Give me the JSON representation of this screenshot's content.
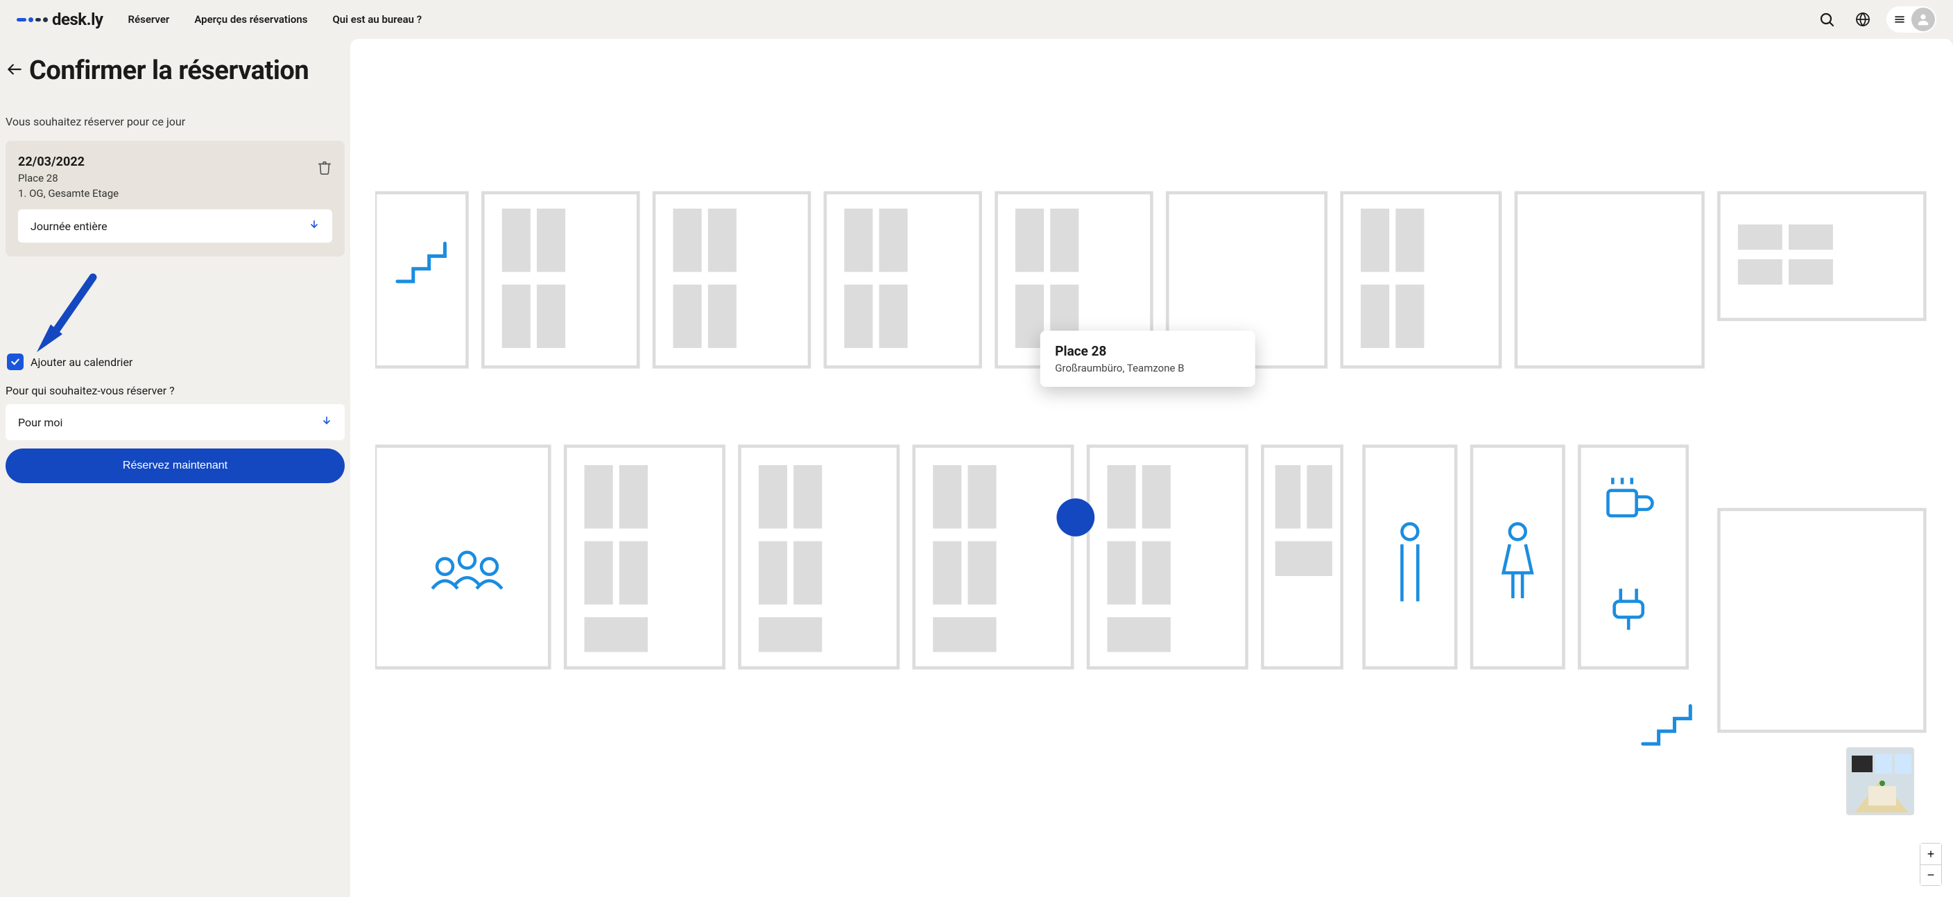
{
  "brand": {
    "name": "desk.ly"
  },
  "nav": {
    "reserve": "Réserver",
    "overview": "Aperçu des réservations",
    "who": "Qui est au bureau ?"
  },
  "page": {
    "title": "Confirmer la réservation"
  },
  "sidebar": {
    "subheading": "Vous souhaitez réserver pour ce jour",
    "booking": {
      "date": "22/03/2022",
      "place": "Place 28",
      "floor": "1. OG, Gesamte Etage",
      "duration": "Journée entière"
    },
    "add_calendar_label": "Ajouter au calendrier",
    "for_whom_label": "Pour qui souhaitez-vous réserver ?",
    "for_whom_value": "Pour moi",
    "reserve_button": "Réservez maintenant"
  },
  "tooltip": {
    "title": "Place 28",
    "subtitle": "Großraumbüro, Teamzone B"
  },
  "zoom": {
    "in": "+",
    "out": "−"
  },
  "colors": {
    "accent": "#1a56db",
    "desk": "#dcdcdc",
    "wall": "#dcdcdc"
  }
}
